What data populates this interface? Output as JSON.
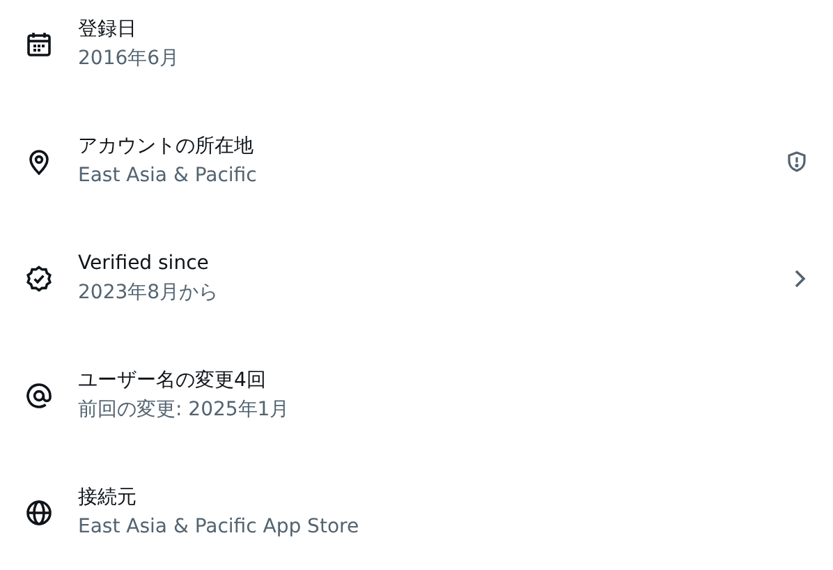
{
  "items": [
    {
      "kind": "plain",
      "title": "登録日",
      "subtitle": "2016年6月"
    },
    {
      "kind": "alert",
      "title": "アカウントの所在地",
      "subtitle": "East Asia & Pacific"
    },
    {
      "kind": "link",
      "title": "Verified since",
      "subtitle": "2023年8月から"
    },
    {
      "kind": "plain",
      "title": "ユーザー名の変更4回",
      "subtitle": "前回の変更: 2025年1月"
    },
    {
      "kind": "plain",
      "title": "接続元",
      "subtitle": "East Asia & Pacific App Store"
    }
  ]
}
